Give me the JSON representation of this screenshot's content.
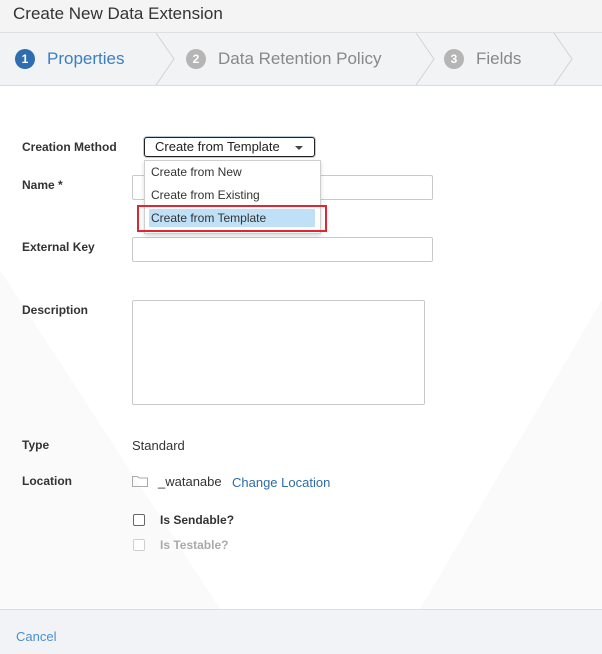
{
  "dialog": {
    "title": "Create New Data Extension"
  },
  "steps": [
    {
      "num": "1",
      "label": "Properties"
    },
    {
      "num": "2",
      "label": "Data Retention Policy"
    },
    {
      "num": "3",
      "label": "Fields"
    }
  ],
  "form": {
    "creation_method": {
      "label": "Creation Method",
      "selected": "Create from Template",
      "options": [
        "Create from New",
        "Create from Existing",
        "Create from Template"
      ]
    },
    "name": {
      "label": "Name *",
      "value": ""
    },
    "external_key": {
      "label": "External Key",
      "value": ""
    },
    "description": {
      "label": "Description",
      "value": ""
    },
    "type": {
      "label": "Type",
      "value": "Standard"
    },
    "location": {
      "label": "Location",
      "folder": "_watanabe",
      "change_link": "Change Location"
    },
    "is_sendable": {
      "label": "Is Sendable?",
      "checked": false
    },
    "is_testable": {
      "label": "Is Testable?",
      "checked": false,
      "disabled": true
    }
  },
  "footer": {
    "cancel": "Cancel"
  },
  "colors": {
    "accent": "#2e6db0",
    "link": "#2f6ca8",
    "highlight": "#e0262e",
    "selected_option": "#bfe0f6"
  }
}
